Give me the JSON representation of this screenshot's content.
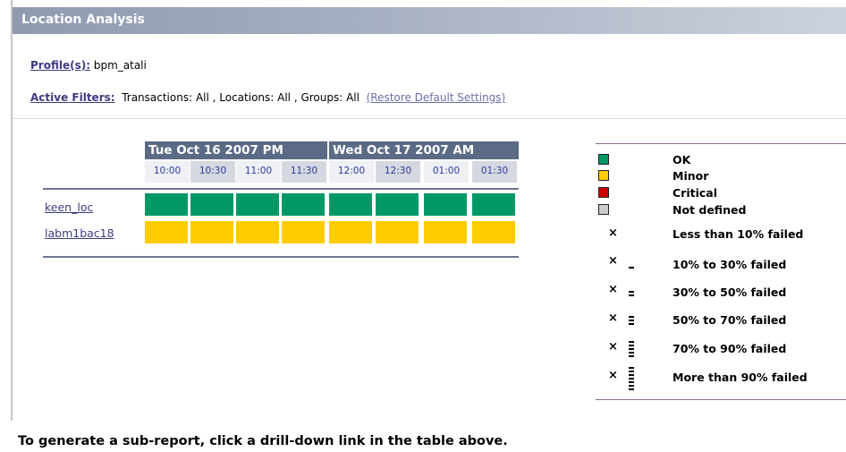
{
  "title": "Location Analysis",
  "profile": {
    "label": "Profile(s):",
    "value": "bpm_atali"
  },
  "filters": {
    "label": "Active Filters:",
    "text": "Transactions: All , Locations: All , Groups: All",
    "restore_link": "(Restore Default Settings)"
  },
  "grid": {
    "dates": [
      "Tue Oct 16 2007 PM",
      "Wed Oct 17 2007 AM"
    ],
    "times": [
      "10:00",
      "10:30",
      "11:00",
      "11:30",
      "12:00",
      "12:30",
      "01:00",
      "01:30"
    ],
    "rows": [
      {
        "label": "keen_loc",
        "statuses": [
          "ok",
          "ok",
          "ok",
          "ok",
          "ok",
          "ok",
          "ok",
          "ok"
        ]
      },
      {
        "label": "labm1bac18",
        "statuses": [
          "minor",
          "minor",
          "minor",
          "minor",
          "minor",
          "minor",
          "minor",
          "minor"
        ]
      }
    ]
  },
  "legend": {
    "colors": [
      {
        "label": "OK",
        "color": "#009966"
      },
      {
        "label": "Minor",
        "color": "#ffcc00"
      },
      {
        "label": "Critical",
        "color": "#cc0000"
      },
      {
        "label": "Not defined",
        "color": "#cccccc"
      }
    ],
    "failures": [
      {
        "label": "Less than 10% failed",
        "bars": 0
      },
      {
        "label": "10% to 30% failed",
        "bars": 1
      },
      {
        "label": "30% to 50% failed",
        "bars": 2
      },
      {
        "label": "50% to 70% failed",
        "bars": 3
      },
      {
        "label": "70% to 90% failed",
        "bars": 5
      },
      {
        "label": "More than 90% failed",
        "bars": 7
      }
    ],
    "mark": "×"
  },
  "footer": "To generate a sub-report, click a drill-down link in the table above.",
  "status_colors": {
    "ok": "#009966",
    "minor": "#ffcc00"
  }
}
